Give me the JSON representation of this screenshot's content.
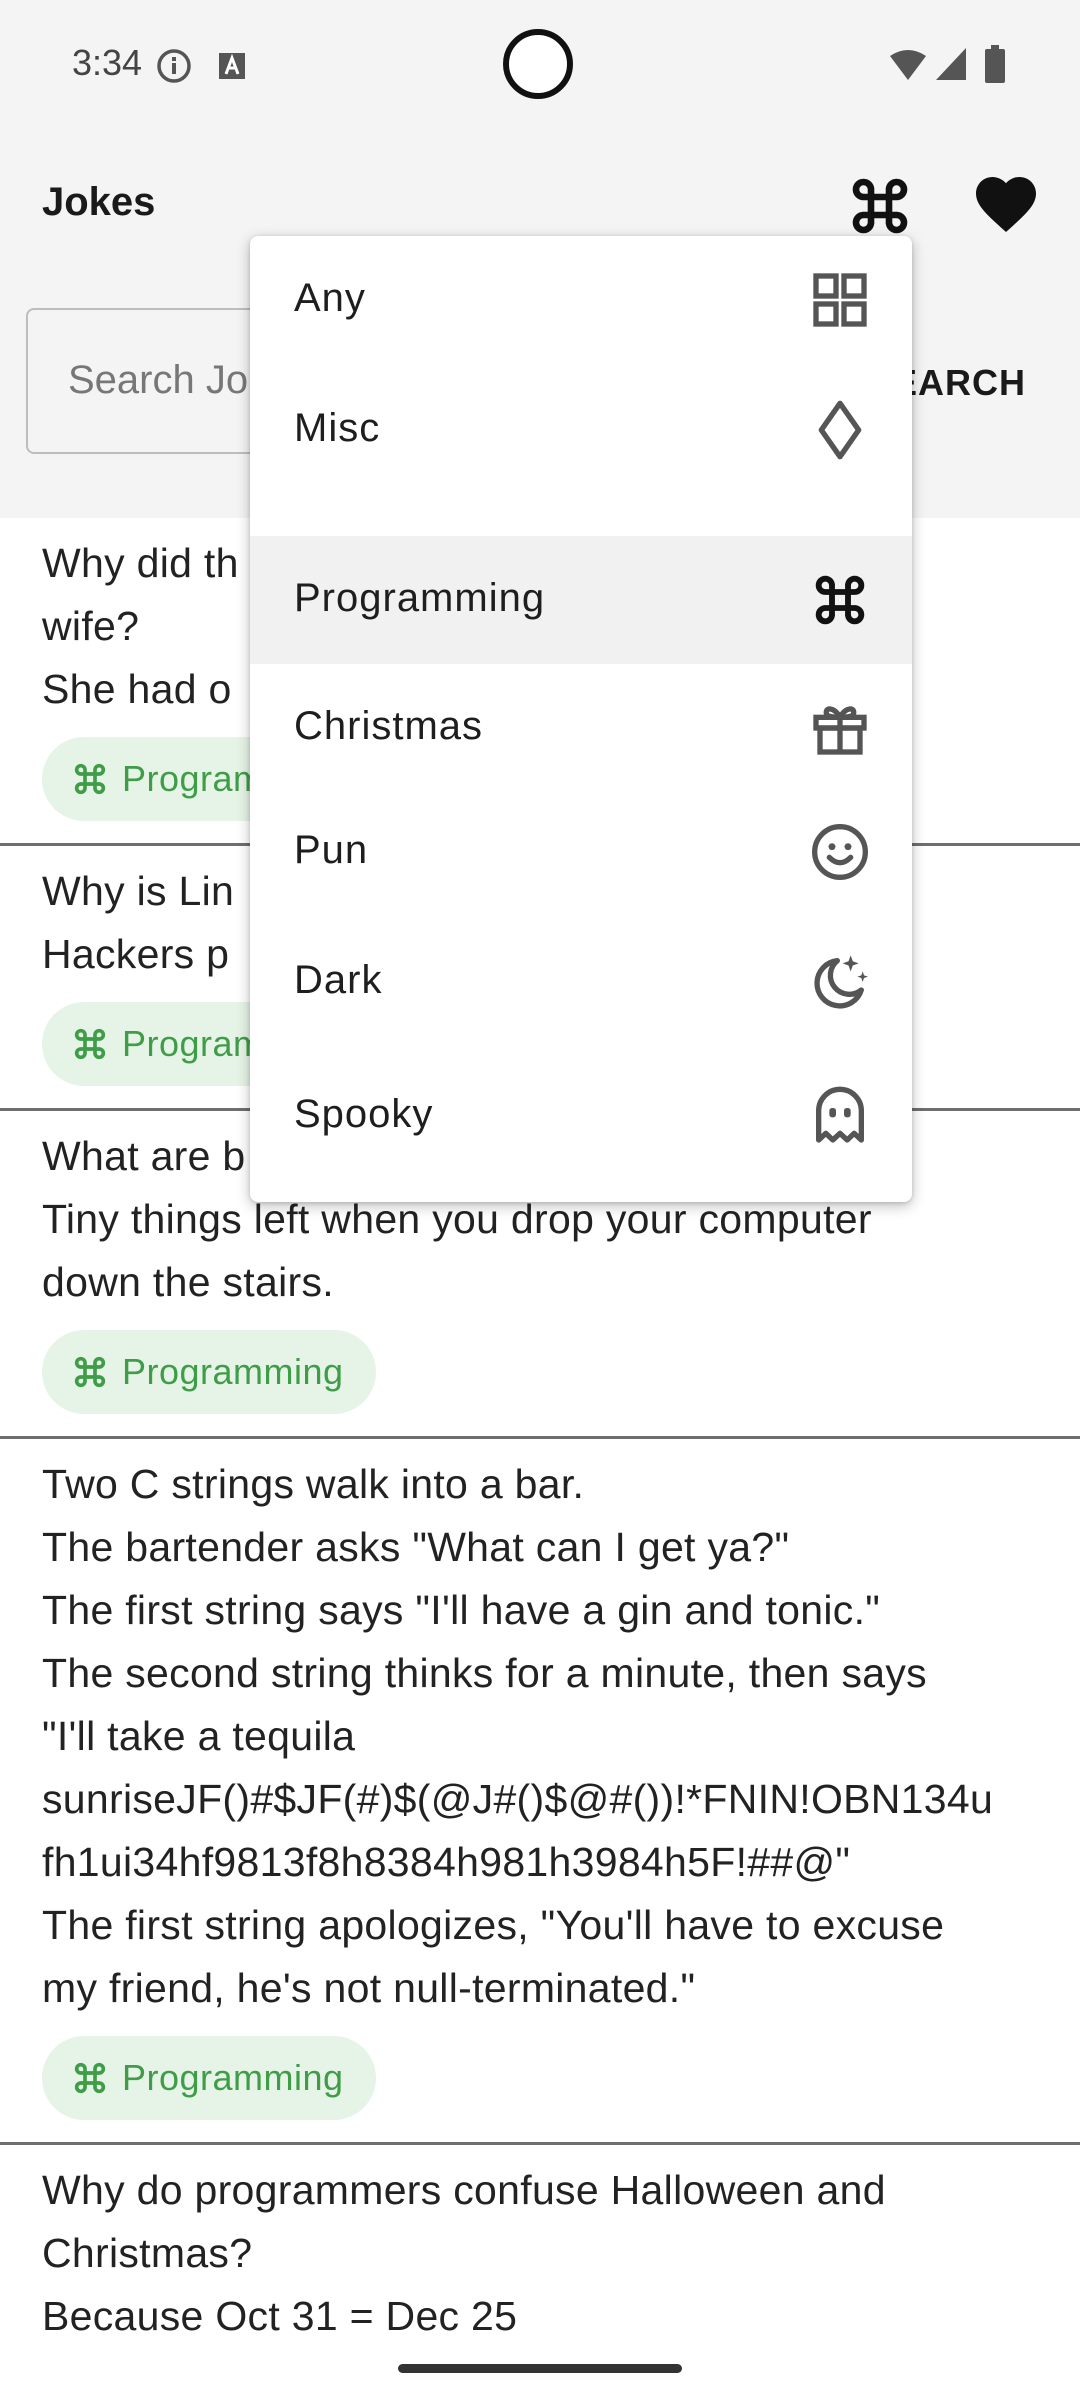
{
  "status_bar": {
    "time": "3:34"
  },
  "app_bar": {
    "title": "Jokes"
  },
  "search": {
    "placeholder": "Search Jokes",
    "button_label": "SEARCH"
  },
  "colors": {
    "chip_bg": "#e6f4e7",
    "chip_text": "#3f9d48",
    "topbar_bg": "#f4f4f4"
  },
  "category_menu": {
    "items": [
      {
        "label": "Any",
        "icon": "grid-icon"
      },
      {
        "label": "Misc",
        "icon": "diamond-icon"
      },
      {
        "label": "Programming",
        "icon": "command-icon",
        "selected": true
      },
      {
        "label": "Christmas",
        "icon": "gift-icon"
      },
      {
        "label": "Pun",
        "icon": "smiley-icon"
      },
      {
        "label": "Dark",
        "icon": "moon-stars-icon"
      },
      {
        "label": "Spooky",
        "icon": "ghost-icon"
      }
    ]
  },
  "jokes": [
    {
      "text": "Why did th                                              his\nwife?\nShe had o",
      "category": "Programming"
    },
    {
      "text": "Why is Lin\nHackers p",
      "category": "Programming"
    },
    {
      "text": "What are b\nTiny things left when you drop your computer\ndown the stairs.",
      "category": "Programming"
    },
    {
      "text": "Two C strings walk into a bar.\nThe bartender asks \"What can I get ya?\"\nThe first string says \"I'll have a gin and tonic.\"\nThe second string thinks for a minute, then says\n\"I'll take a tequila\nsunriseJF()#$JF(#)$(@J#()$@#())!*FNIN!OBN134u\nfh1ui34hf9813f8h8384h981h3984h5F!##@\"\nThe first string apologizes, \"You'll have to excuse\nmy friend, he's not null-terminated.\"",
      "category": "Programming"
    },
    {
      "text": "Why do programmers confuse Halloween and\nChristmas?\nBecause Oct 31 = Dec 25",
      "category": ""
    }
  ]
}
